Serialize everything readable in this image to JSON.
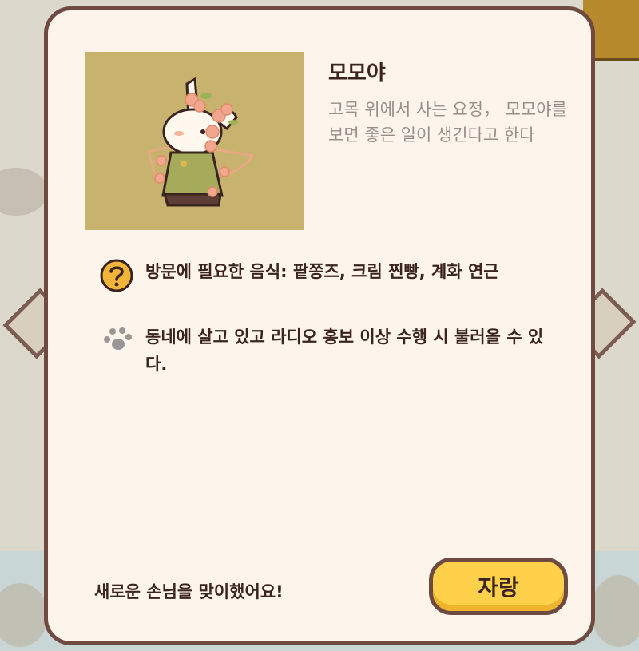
{
  "character": {
    "name": "모모야",
    "description": "고목 위에서 사는 요정， 모모야를 보면 좋은 일이 생긴다고 한다"
  },
  "info": {
    "food": "방문에 필요한 음식: 팥쫑즈, 크림 찐빵, 계화 연근",
    "condition": "동네에 살고 있고 라디오 홍보 이상 수행 시 불러올 수 있다."
  },
  "footer": {
    "message": "새로운 손님을 맞이했어요!",
    "brag_label": "자랑"
  },
  "icons": {
    "food": "question-icon",
    "condition": "paw-icon"
  },
  "colors": {
    "panel": "#fdf5ec",
    "border": "#6e4a40",
    "portrait_bg": "#c7b26e",
    "button": "#ffd14a",
    "question_icon": "#f2b53a"
  }
}
